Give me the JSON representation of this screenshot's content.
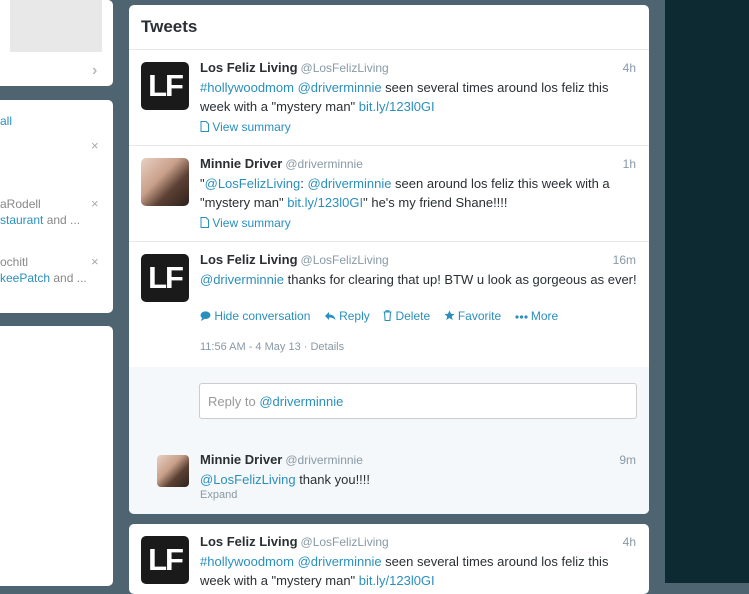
{
  "sidebar": {
    "view_all": "all",
    "suggestions": [
      {
        "user": "aRodell",
        "sub_link": "staurant",
        "sub_rest": " and ..."
      },
      {
        "user": "ochitl",
        "sub_link": "keePatch",
        "sub_rest": " and ..."
      }
    ],
    "close_glyph": "×",
    "chevron_glyph": "›"
  },
  "timeline": {
    "title": "Tweets",
    "tweets": [
      {
        "name": "Los Feliz Living",
        "handle": "@LosFelizLiving",
        "time": "4h",
        "hashtag": "#hollywoodmom",
        "mention": "@driverminnie",
        "text": " seen several times around los feliz this week with a \"mystery man\" ",
        "link": "bit.ly/123l0GI",
        "summary": "View summary"
      },
      {
        "name": "Minnie Driver",
        "handle": "@driverminnie",
        "time": "1h",
        "quote_open": "\"",
        "mention1": "@LosFelizLiving",
        "sep": ": ",
        "mention2": "@driverminnie",
        "text": " seen around los feliz this week with a \"mystery man\" ",
        "link": "bit.ly/123l0GI",
        "tail": "\" he's my friend Shane!!!!",
        "summary": "View summary"
      },
      {
        "name": "Los Feliz Living",
        "handle": "@LosFelizLiving",
        "time": "16m",
        "mention": "@driverminnie",
        "text": " thanks for clearing that up!  BTW u look as gorgeous as ever!",
        "actions": {
          "hide": "Hide conversation",
          "reply": "Reply",
          "delete": "Delete",
          "favorite": "Favorite",
          "more": "More"
        },
        "timestamp": "11:56 AM - 4 May 13",
        "details": "Details",
        "meta_sep": " · "
      }
    ],
    "reply_box": {
      "prefix": "Reply to ",
      "mention": "@driverminnie"
    },
    "sub_reply": {
      "name": "Minnie Driver",
      "handle": "@driverminnie",
      "time": "9m",
      "mention": "@LosFelizLiving",
      "text": " thank you!!!!",
      "expand": "Expand"
    },
    "next_tweet": {
      "name": "Los Feliz Living",
      "handle": "@LosFelizLiving",
      "time": "4h",
      "hashtag": "#hollywoodmom",
      "mention": "@driverminnie",
      "text": " seen several times around los feliz this week with a \"mystery man\" ",
      "link": "bit.ly/123l0GI"
    }
  },
  "avatar_initials": "LF",
  "colors": {
    "link": "#2a8fbd",
    "bg": "#4e6470",
    "dark_bg": "#0d2a33"
  }
}
